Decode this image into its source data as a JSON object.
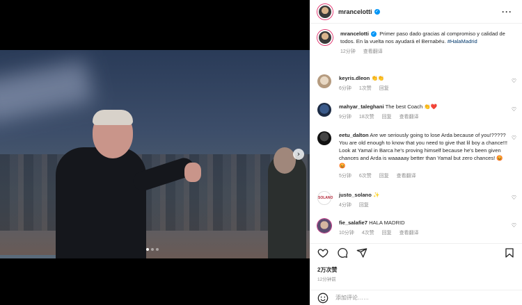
{
  "post": {
    "username": "mrancelotti",
    "caption": "Primer paso dado gracias al compromiso y calidad de todos. En la vuelta nos ayudará el Bernabéu.",
    "hashtag": "#HalaMadrid",
    "caption_time": "12分钟",
    "see_translation": "查看翻译",
    "likes": "2万次赞",
    "time_ago": "12分钟前",
    "add_comment_placeholder": "添加评论……",
    "carousel": {
      "slides": 3,
      "active": 1
    }
  },
  "comments": [
    {
      "user": "keyris.dleon",
      "text": "👏👏",
      "time": "6分钟",
      "likes": "1次赞",
      "reply": "回复",
      "translate": ""
    },
    {
      "user": "mahyar_taleghani",
      "text": "The best Coach 👏❤️",
      "time": "9分钟",
      "likes": "18次赞",
      "reply": "回复",
      "translate": "查看翻译"
    },
    {
      "user": "eetu_dalton",
      "text": "Are we seriously going to lose Arda because of you!????? You are old enough to know that you need to give that lil boy a chance!!! Look at Yamal in Barca he's proving himself because he's been given chances and Arda is waaaaay better than Yamal but zero chances! 😡😡",
      "time": "5分钟",
      "likes": "6次赞",
      "reply": "回复",
      "translate": "查看翻译"
    },
    {
      "user": "justo_solano",
      "text": "✨",
      "time": "4分钟",
      "likes": "",
      "reply": "回复",
      "translate": ""
    },
    {
      "user": "fie_salafie7",
      "text": "HALA MADRID",
      "time": "10分钟",
      "likes": "4次赞",
      "reply": "回复",
      "translate": "查看翻译"
    }
  ],
  "icons": {
    "more": "more-options-icon",
    "like": "heart-icon",
    "comment": "comment-icon",
    "share": "send-icon",
    "save": "bookmark-icon",
    "emoji": "emoji-icon",
    "next": "chevron-right-icon"
  },
  "colors": {
    "verified": "#0095f6",
    "hashtag": "#00376b",
    "muted": "#8e8e8e"
  }
}
